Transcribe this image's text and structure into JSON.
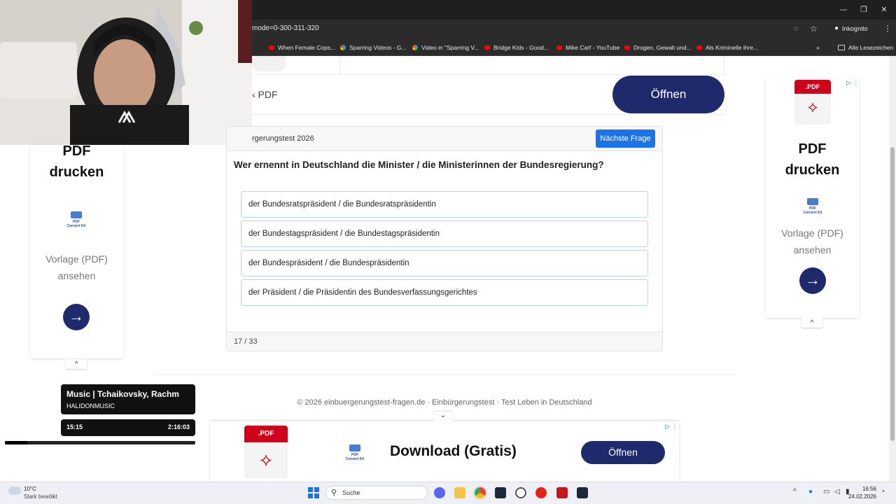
{
  "browser": {
    "url": "mode=0-300-311-320",
    "incognito_label": "Inkognito",
    "all_bookmarks": "Alle Lesezeichen",
    "bookmarks": [
      {
        "label": "When Female Cops..."
      },
      {
        "label": "Sparring Videos - G..."
      },
      {
        "label": "Video in \"Sparring V..."
      },
      {
        "label": "Bridge Kids - Good..."
      },
      {
        "label": "Mike Carf - YouTube"
      },
      {
        "label": "Drogen, Gewalt und..."
      },
      {
        "label": "Als Kriminelle ihre..."
      }
    ],
    "overflow": "»"
  },
  "top_ad": {
    "back_label": "‹ PDF",
    "open_button": "Öffnen"
  },
  "left_ad": {
    "title_line1": "PDF",
    "title_line2": "drucken",
    "logo_text": "PDF Convert Kit",
    "sub_line1": "Vorlage (PDF)",
    "sub_line2": "ansehen",
    "collapse": "^"
  },
  "right_ad": {
    "badge": ".PDF",
    "title_line1": "PDF",
    "title_line2": "drucken",
    "logo_text": "PDF Convert Kit",
    "sub_line1": "Vorlage (PDF)",
    "sub_line2": "ansehen",
    "collapse": "^"
  },
  "quiz": {
    "header_title": "rgerungstest 2026",
    "next_button": "Nächste Frage",
    "question": "Wer ernennt in Deutschland die Minister / die Ministerinnen der Bundesregierung?",
    "answers": [
      "der Bundesratspräsident / die Bundesratspräsidentin",
      "der Bundestagspräsident / die Bundestagspräsidentin",
      "der Bundespräsident / die Bundespräsidentin",
      "der Präsident / die Präsidentin des Bundesverfassungsgerichtes"
    ],
    "progress": "17 / 33"
  },
  "footer": {
    "text": "© 2026 einbuergerungstest-fragen.de · Einbürgerungstest · Test Leben in Deutschland"
  },
  "bottom_ad": {
    "badge": ".PDF",
    "logo_text": "PDF Convert Kit",
    "title": "Download (Gratis)",
    "open_button": "Öffnen",
    "collapse": "⌄"
  },
  "music_widget": {
    "title": "Music | Tchaikovsky, Rachm",
    "channel": "HALIDONMUSIC",
    "time_current": "15:15",
    "time_total": "2:16:03",
    "progress": 0.117
  },
  "taskbar": {
    "weather_temp": "10°C",
    "weather_desc": "Stark bewölkt",
    "search_placeholder": "Suche",
    "time": "16:56",
    "date": "24.02.2026"
  },
  "colors": {
    "accent_navy": "#1e2a6b",
    "next_button_blue": "#1a73e8",
    "pdf_red": "#d0021b"
  }
}
